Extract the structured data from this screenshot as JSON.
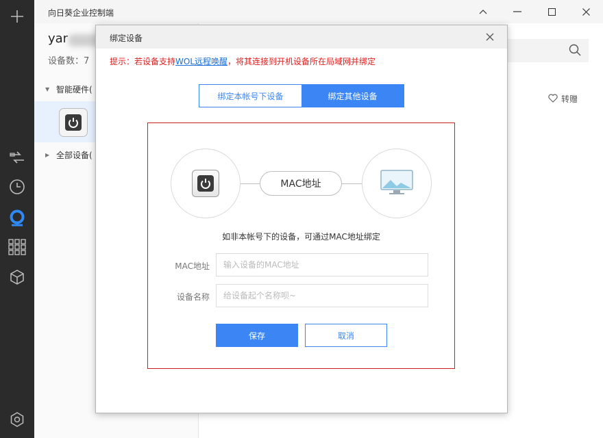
{
  "app": {
    "title": "向日葵企业控制端",
    "user_name": "yar",
    "device_count": "设备数：7"
  },
  "tree": {
    "smart_hardware": "智能硬件(",
    "all_devices": "全部设备("
  },
  "workspace": {
    "gift_label": "转赠"
  },
  "rail_icons": [
    "add-icon",
    "remote-icon",
    "history-icon",
    "sunlogin-icon",
    "apps-icon",
    "cube-icon",
    "settings-icon"
  ],
  "modal": {
    "title": "绑定设备",
    "tip_prefix": "提示：若设备支持",
    "tip_link": "WOL远程唤醒",
    "tip_suffix": "，将其连接到开机设备所在局域网并绑定",
    "tabs": [
      {
        "label": "绑定本帐号下设备",
        "active": false
      },
      {
        "label": "绑定其他设备",
        "active": true
      }
    ],
    "mac_pill": "MAC地址",
    "hint": "如非本帐号下的设备，可通过MAC地址绑定",
    "mac_label": "MAC地址",
    "mac_placeholder": "输入设备的MAC地址",
    "mac_value": "",
    "name_label": "设备名称",
    "name_placeholder": "给设备起个名称呗~",
    "name_value": "",
    "save_label": "保存",
    "cancel_label": "取消"
  },
  "colors": {
    "accent": "#3b86f4",
    "tip_red": "#e02020",
    "rail_bg": "#2b2b2b",
    "rail_active": "#2f8af5",
    "highlight_border": "#d31b1b"
  }
}
